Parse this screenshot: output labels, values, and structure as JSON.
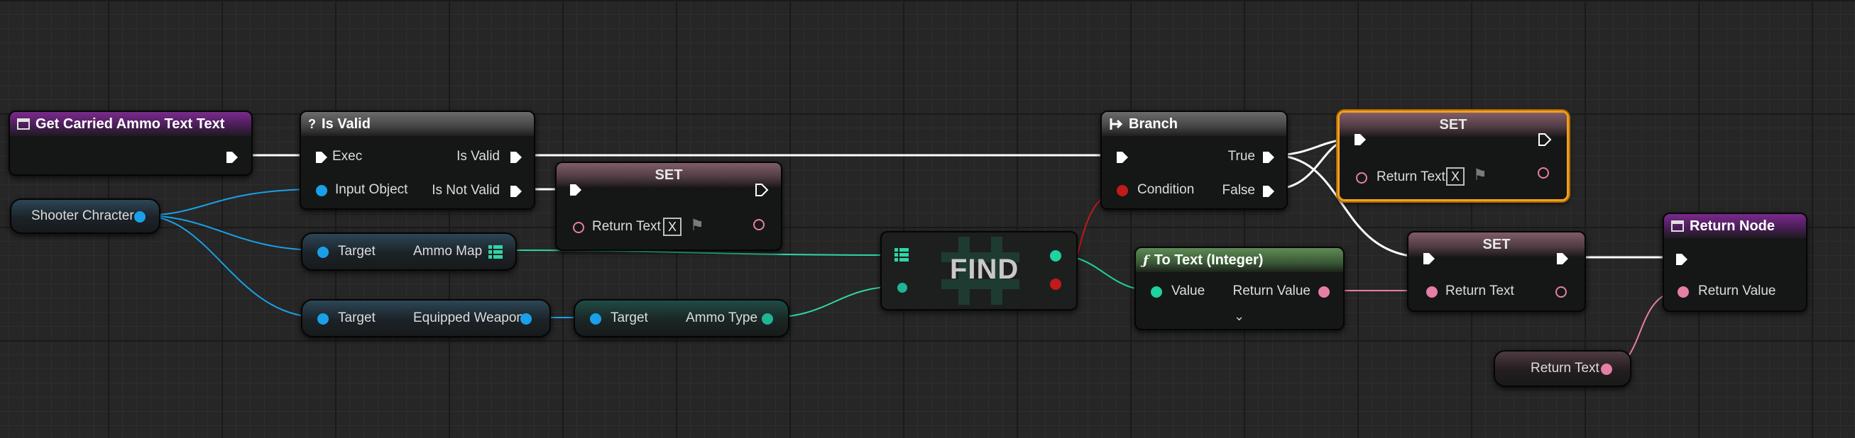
{
  "graph": {
    "colors": {
      "exec": "#ffffff",
      "object": "#1aa0e8",
      "map_pin": "#2fd5a8",
      "bool": "#c01a1a",
      "text": "#e67fa6",
      "int": "#1fd2a0",
      "selection": "#f0a020"
    },
    "nodes": {
      "entry": {
        "title": "Get Carried Ammo Text Text",
        "icon": "function-entry-icon"
      },
      "is_valid": {
        "title": "Is Valid",
        "icon": "question-icon",
        "exec_label": "Exec",
        "input_label": "Input Object",
        "out_valid": "Is Valid",
        "out_not_valid": "Is Not Valid"
      },
      "set_1": {
        "title": "SET",
        "pin_label": "Return Text",
        "x_value": "X"
      },
      "shooter": {
        "label": "Shooter Chracter"
      },
      "get_ammo_map": {
        "target_label": "Target",
        "out_label": "Ammo Map"
      },
      "get_weapon": {
        "target_label": "Target",
        "out_label": "Equipped Weapon"
      },
      "get_ammo_type": {
        "target_label": "Target",
        "out_label": "Ammo Type"
      },
      "find": {
        "title": "FIND"
      },
      "branch": {
        "title": "Branch",
        "icon": "branch-icon",
        "cond_label": "Condition",
        "true_label": "True",
        "false_label": "False"
      },
      "set_2": {
        "title": "SET",
        "pin_label": "Return Text",
        "x_value": "X"
      },
      "to_text": {
        "title": "To Text (Integer)",
        "icon": "function-icon",
        "in_label": "Value",
        "out_label": "Return Value",
        "expand_icon": "chevron-down-icon"
      },
      "set_3": {
        "title": "SET",
        "pin_label": "Return Text"
      },
      "return_node": {
        "title": "Return Node",
        "icon": "function-entry-icon",
        "in_label": "Return Value"
      },
      "return_text_var": {
        "label": "Return Text"
      }
    }
  }
}
